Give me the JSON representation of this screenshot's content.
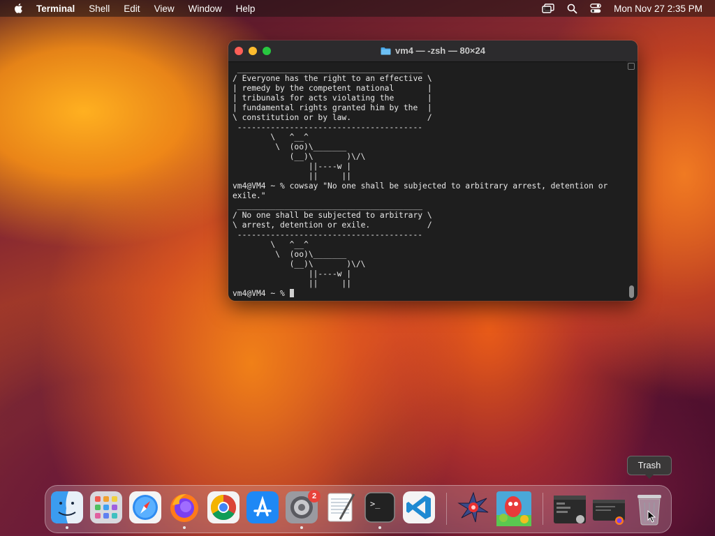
{
  "menubar": {
    "app_name": "Terminal",
    "items": [
      "Shell",
      "Edit",
      "View",
      "Window",
      "Help"
    ],
    "clock": "Mon Nov 27  2:35 PM",
    "status_icons": [
      "screen-mirroring-icon",
      "spotlight-search-icon",
      "control-center-icon"
    ]
  },
  "terminal": {
    "title": "vm4 — -zsh — 80×24",
    "lines": [
      " _______________________________________",
      "/ Everyone has the right to an effective \\",
      "| remedy by the competent national       |",
      "| tribunals for acts violating the       |",
      "| fundamental rights granted him by the  |",
      "\\ constitution or by law.                /",
      " ---------------------------------------",
      "        \\   ^__^",
      "         \\  (oo)\\_______",
      "            (__)\\       )\\/\\",
      "                ||----w |",
      "                ||     ||",
      "vm4@VM4 ~ % cowsay \"No one shall be subjected to arbitrary arrest, detention or ",
      "exile.\"",
      " _______________________________________",
      "/ No one shall be subjected to arbitrary \\",
      "\\ arrest, detention or exile.            /",
      " ---------------------------------------",
      "        \\   ^__^",
      "         \\  (oo)\\_______",
      "            (__)\\       )\\/\\",
      "                ||----w |",
      "                ||     ||",
      "vm4@VM4 ~ % "
    ]
  },
  "tooltip": {
    "label": "Trash"
  },
  "dock": {
    "items": [
      {
        "name": "Finder",
        "icon": "finder-icon",
        "running": true
      },
      {
        "name": "Launchpad",
        "icon": "launchpad-icon",
        "running": false
      },
      {
        "name": "Safari",
        "icon": "safari-icon",
        "running": false
      },
      {
        "name": "Firefox",
        "icon": "firefox-icon",
        "running": true
      },
      {
        "name": "Google Chrome",
        "icon": "chrome-icon",
        "running": false
      },
      {
        "name": "App Store",
        "icon": "app-store-icon",
        "running": false
      },
      {
        "name": "System Settings",
        "icon": "system-settings-icon",
        "running": true,
        "badge": "2"
      },
      {
        "name": "TextEdit",
        "icon": "textedit-icon",
        "running": false
      },
      {
        "name": "Terminal",
        "icon": "terminal-icon",
        "running": true
      },
      {
        "name": "Visual Studio Code",
        "icon": "vscode-icon",
        "running": false
      },
      {
        "name": "Star App",
        "icon": "spiky-star-icon",
        "running": false
      },
      {
        "name": "Game App",
        "icon": "game-characters-icon",
        "running": false
      },
      {
        "name": "Minimized Window 1",
        "icon": "window-thumbnail-icon",
        "running": false
      },
      {
        "name": "Minimized Window 2",
        "icon": "window-thumbnail-icon",
        "running": false
      },
      {
        "name": "Trash",
        "icon": "trash-icon",
        "running": false
      }
    ]
  },
  "colors": {
    "terminal_bg": "#1e1e1e",
    "traffic_red": "#fe5f57",
    "traffic_yellow": "#febc2e",
    "traffic_green": "#28c840",
    "badge": "#e8423a"
  }
}
